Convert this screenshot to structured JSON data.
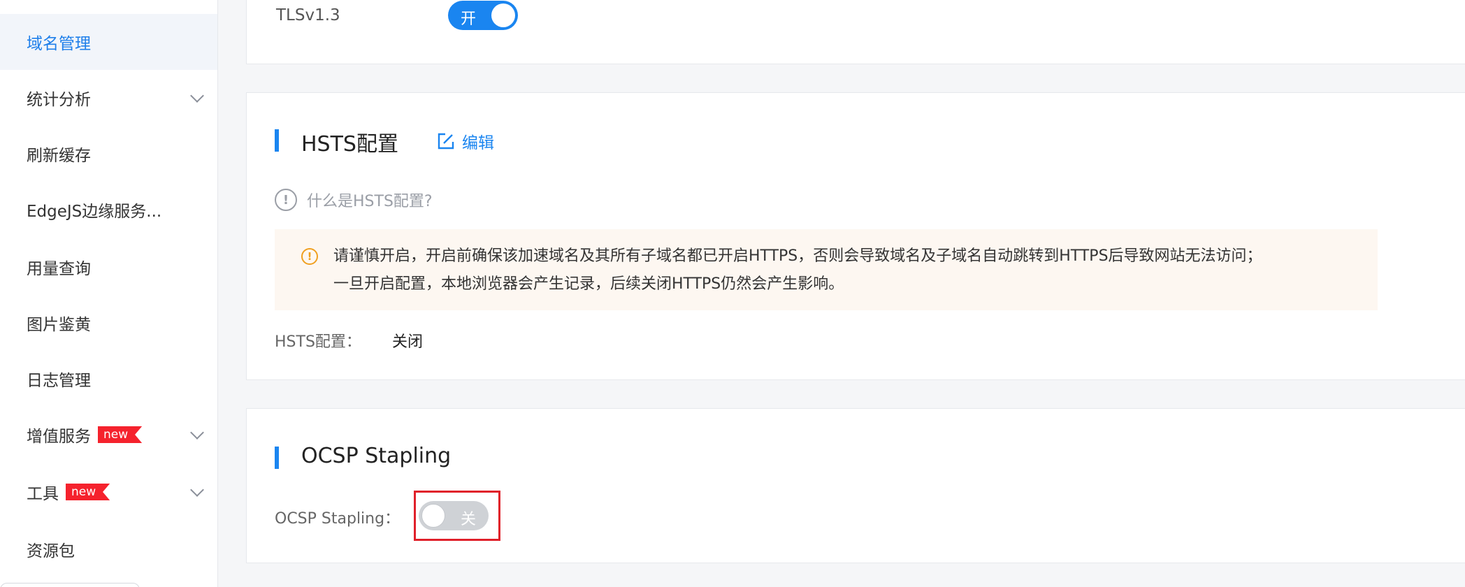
{
  "sidebar": {
    "items": [
      {
        "label": "域名管理",
        "active": true,
        "chevron": false
      },
      {
        "label": "统计分析",
        "chevron": true
      },
      {
        "label": "刷新缓存",
        "chevron": false
      },
      {
        "label": "EdgeJS边缘服务...",
        "chevron": false
      },
      {
        "label": "用量查询",
        "chevron": false
      },
      {
        "label": "图片鉴黄",
        "chevron": false
      },
      {
        "label": "日志管理",
        "chevron": false
      },
      {
        "label": "增值服务",
        "badge": "new",
        "chevron": true
      },
      {
        "label": "工具",
        "badge": "new",
        "chevron": true
      },
      {
        "label": "资源包",
        "chevron": false
      }
    ]
  },
  "tls_card": {
    "label": "TLSv1.3",
    "switch_state": "开"
  },
  "hsts_card": {
    "title": "HSTS配置",
    "edit_label": "编辑",
    "info_text": "什么是HSTS配置?",
    "warning_lines": [
      "请谨慎开启，开启前确保该加速域名及其所有子域名都已开启HTTPS，否则会导致域名及子域名自动跳转到HTTPS后导致网站无法访问；",
      "一旦开启配置，本地浏览器会产生记录，后续关闭HTTPS仍然会产生影响。"
    ],
    "field_label": "HSTS配置：",
    "field_value": "关闭"
  },
  "ocsp_card": {
    "title": "OCSP Stapling",
    "field_label": "OCSP Stapling：",
    "switch_state": "关"
  },
  "colors": {
    "accent": "#1a85f0",
    "badge": "#f5222d",
    "highlight": "#e0202a",
    "warning": "#f0a020"
  }
}
